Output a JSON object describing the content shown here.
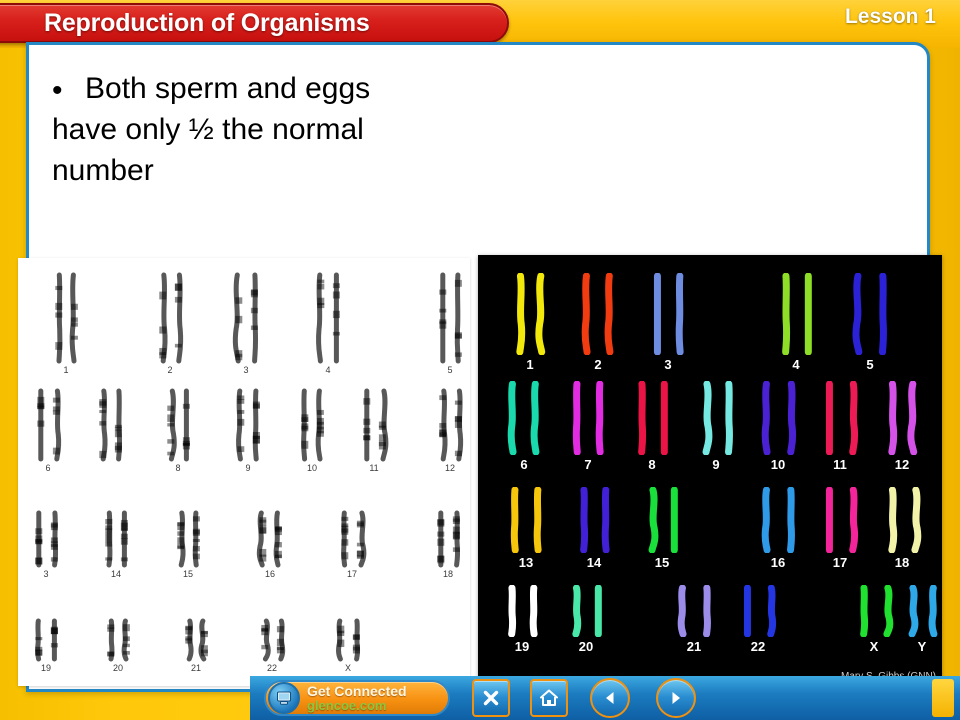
{
  "header": {
    "title": "Reproduction of Organisms",
    "lesson_badge": "Lesson 1",
    "banner_color": "#d8201c",
    "background_color": "#ffc80a",
    "frame_color": "#2488c4"
  },
  "slide": {
    "bullet_marker": "•",
    "bullet_text": "Both sperm and eggs have only ½ the normal number"
  },
  "karyotype_grayscale": {
    "label": "grayscale-banded-karyotype",
    "rows": [
      {
        "labels": [
          "1",
          "2",
          "3",
          "4",
          "5"
        ]
      },
      {
        "labels": [
          "6",
          "",
          "8",
          "9",
          "10",
          "11",
          "12"
        ]
      },
      {
        "labels": [
          "3",
          "14",
          "15",
          "16",
          "17",
          "18"
        ]
      },
      {
        "labels": [
          "19",
          "20",
          "21",
          "22",
          "X"
        ]
      }
    ]
  },
  "karyotype_color": {
    "label": "fluorescent-spectral-karyotype",
    "credit": "Mary S. Gibbs (GNN)",
    "background_color": "#000000",
    "rows": [
      {
        "pairs": [
          {
            "label": "1",
            "color": "#f2e80c"
          },
          {
            "label": "2",
            "color": "#f03c10"
          },
          {
            "label": "3",
            "color": "#6e8ce0"
          },
          {
            "label": "4",
            "color": "#8ede28"
          },
          {
            "label": "5",
            "color": "#2b22d8"
          }
        ]
      },
      {
        "pairs": [
          {
            "label": "6",
            "color": "#19d9ad"
          },
          {
            "label": "7",
            "color": "#e12ce1"
          },
          {
            "label": "8",
            "color": "#ea1446"
          },
          {
            "label": "9",
            "color": "#76e8e2"
          },
          {
            "label": "10",
            "color": "#4a22d4"
          },
          {
            "label": "11",
            "color": "#ec1a55"
          },
          {
            "label": "12",
            "color": "#d452e8"
          }
        ]
      },
      {
        "pairs": [
          {
            "label": "13",
            "color": "#f5c60c"
          },
          {
            "label": "14",
            "color": "#4220d6"
          },
          {
            "label": "15",
            "color": "#1ae03c"
          },
          {
            "label": "16",
            "color": "#2f9ae8"
          },
          {
            "label": "17",
            "color": "#f4249a"
          },
          {
            "label": "18",
            "color": "#f2f2a8"
          }
        ]
      },
      {
        "pairs": [
          {
            "label": "19",
            "color": "#ffffff"
          },
          {
            "label": "20",
            "color": "#4ae8a8"
          },
          {
            "label": "21",
            "color": "#9a8ce8"
          },
          {
            "label": "22",
            "color": "#2436e2"
          },
          {
            "label": "X",
            "color": "#20e030"
          },
          {
            "label": "Y",
            "color": "#2fa8e8"
          }
        ]
      }
    ]
  },
  "nav": {
    "get_connected_line1": "Get Connected",
    "get_connected_line2": "glencoe.com",
    "close_glyph": "✕",
    "home_glyph": "⌂",
    "back_glyph": "◀",
    "forward_glyph": "▶"
  }
}
